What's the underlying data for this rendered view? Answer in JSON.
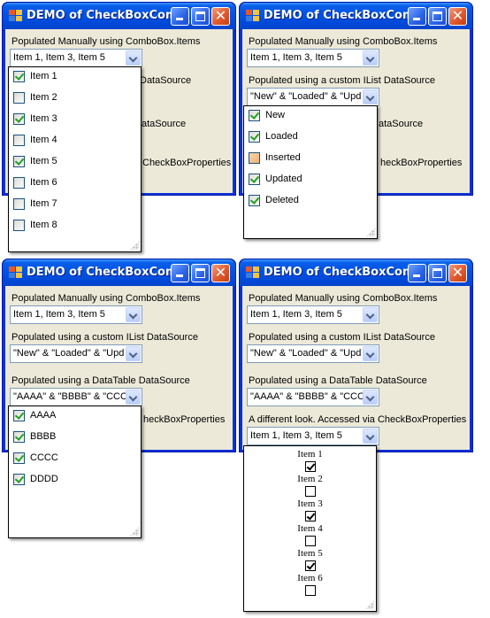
{
  "window_title": "DEMO of CheckBoxCom...",
  "labels": {
    "manual": "Populated Manually using ComboBox.Items",
    "ilist": "Populated using a custom IList DataSource",
    "datatable": "Populated using a DataTable DataSource",
    "different": "A different look. Accessed via CheckBoxProperties"
  },
  "partial_labels": {
    "ilist": "DataSource",
    "datatable": "ataSource",
    "datatable_b": "ataSource",
    "different": "CheckBoxProperties",
    "different_b": "heckBoxProperties"
  },
  "combo_values": {
    "manual": "Item 1, Item 3, Item 5",
    "ilist": "\"New\" & \"Loaded\" & \"Upd",
    "datatable": "\"AAAA\" & \"BBBB\" & \"CCC",
    "different": "Item 1, Item 3, Item 5"
  },
  "windows": [
    {
      "name": "window-manual-open",
      "popup": {
        "items": [
          {
            "label": "Item 1",
            "state": "checked"
          },
          {
            "label": "Item 2",
            "state": "unchecked"
          },
          {
            "label": "Item 3",
            "state": "checked"
          },
          {
            "label": "Item 4",
            "state": "unchecked"
          },
          {
            "label": "Item 5",
            "state": "checked"
          },
          {
            "label": "Item 6",
            "state": "unchecked"
          },
          {
            "label": "Item 7",
            "state": "unchecked"
          },
          {
            "label": "Item 8",
            "state": "unchecked"
          }
        ]
      }
    },
    {
      "name": "window-ilist-open",
      "popup": {
        "items": [
          {
            "label": "New",
            "state": "checked"
          },
          {
            "label": "Loaded",
            "state": "checked"
          },
          {
            "label": "Inserted",
            "state": "indeterminate"
          },
          {
            "label": "Updated",
            "state": "checked"
          },
          {
            "label": "Deleted",
            "state": "checked"
          }
        ]
      }
    },
    {
      "name": "window-datatable-open",
      "popup": {
        "items": [
          {
            "label": "AAAA",
            "state": "checked"
          },
          {
            "label": "BBBB",
            "state": "checked"
          },
          {
            "label": "CCCC",
            "state": "checked"
          },
          {
            "label": "DDDD",
            "state": "checked"
          }
        ]
      }
    },
    {
      "name": "window-different-look-open",
      "popup": {
        "items": [
          {
            "label": "Item 1",
            "state": "checked"
          },
          {
            "label": "Item 2",
            "state": "unchecked"
          },
          {
            "label": "Item 3",
            "state": "checked"
          },
          {
            "label": "Item 4",
            "state": "unchecked"
          },
          {
            "label": "Item 5",
            "state": "checked"
          },
          {
            "label": "Item 6",
            "state": "unchecked"
          }
        ]
      }
    }
  ],
  "colors": {
    "titlebar": "#0054e3",
    "client": "#ece9d8",
    "check": "#21a121",
    "close_button": "#e05a2e"
  }
}
